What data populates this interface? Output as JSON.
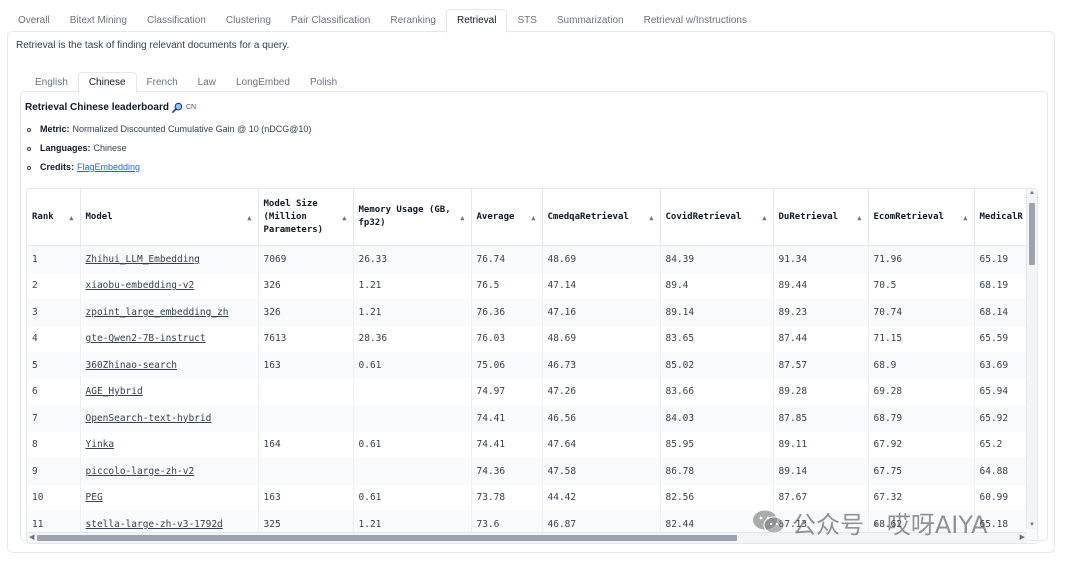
{
  "top_tabs": [
    "Overall",
    "Bitext Mining",
    "Classification",
    "Clustering",
    "Pair Classification",
    "Reranking",
    "Retrieval",
    "STS",
    "Summarization",
    "Retrieval w/Instructions"
  ],
  "top_tab_active": "Retrieval",
  "description": "Retrieval is the task of finding relevant documents for a query.",
  "sub_tabs": [
    "English",
    "Chinese",
    "French",
    "Law",
    "LongEmbed",
    "Polish"
  ],
  "sub_tab_active": "Chinese",
  "leaderboard": {
    "title": "Retrieval Chinese leaderboard",
    "lang_tag": "CN",
    "metric_label": "Metric:",
    "metric_value": "Normalized Discounted Cumulative Gain @ 10 (nDCG@10)",
    "languages_label": "Languages:",
    "languages_value": "Chinese",
    "credits_label": "Credits:",
    "credits_link": "FlagEmbedding"
  },
  "table": {
    "headers": [
      "Rank",
      "Model",
      "Model Size (Million Parameters)",
      "Memory Usage (GB, fp32)",
      "Average",
      "CmedqaRetrieval",
      "CovidRetrieval",
      "DuRetrieval",
      "EcomRetrieval",
      "MedicalR"
    ],
    "rows": [
      [
        "1",
        "Zhihui_LLM_Embedding",
        "7069",
        "26.33",
        "76.74",
        "48.69",
        "84.39",
        "91.34",
        "71.96",
        "65.19"
      ],
      [
        "2",
        "xiaobu-embedding-v2",
        "326",
        "1.21",
        "76.5",
        "47.14",
        "89.4",
        "89.44",
        "70.5",
        "68.19"
      ],
      [
        "3",
        "zpoint_large_embedding_zh",
        "326",
        "1.21",
        "76.36",
        "47.16",
        "89.14",
        "89.23",
        "70.74",
        "68.14"
      ],
      [
        "4",
        "gte-Qwen2-7B-instruct",
        "7613",
        "28.36",
        "76.03",
        "48.69",
        "83.65",
        "87.44",
        "71.15",
        "65.59"
      ],
      [
        "5",
        "360Zhinao-search",
        "163",
        "0.61",
        "75.06",
        "46.73",
        "85.02",
        "87.57",
        "68.9",
        "63.69"
      ],
      [
        "6",
        "AGE_Hybrid",
        "",
        "",
        "74.97",
        "47.26",
        "83.66",
        "89.28",
        "69.28",
        "65.94"
      ],
      [
        "7",
        "OpenSearch-text-hybrid",
        "",
        "",
        "74.41",
        "46.56",
        "84.03",
        "87.85",
        "68.79",
        "65.92"
      ],
      [
        "8",
        "Yinka",
        "164",
        "0.61",
        "74.41",
        "47.64",
        "85.95",
        "89.11",
        "67.92",
        "65.2"
      ],
      [
        "9",
        "piccolo-large-zh-v2",
        "",
        "",
        "74.36",
        "47.58",
        "86.78",
        "89.14",
        "67.75",
        "64.88"
      ],
      [
        "10",
        "PEG",
        "163",
        "0.61",
        "73.78",
        "44.42",
        "82.56",
        "87.67",
        "67.32",
        "60.99"
      ],
      [
        "11",
        "stella-large-zh-v3-1792d",
        "325",
        "1.21",
        "73.6",
        "46.87",
        "82.44",
        "87.13",
        "68.62",
        "65.18"
      ]
    ]
  },
  "watermark": "公众号 · 哎呀AIYA"
}
